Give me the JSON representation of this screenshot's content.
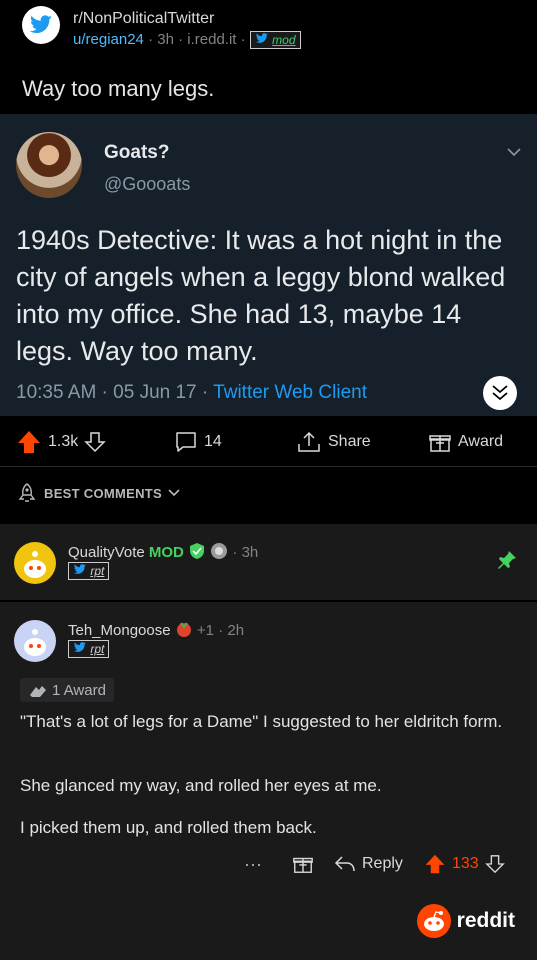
{
  "header": {
    "subreddit": "r/NonPoliticalTwitter",
    "user": "u/regian24",
    "age": "3h",
    "domain": "i.redd.it",
    "flair": "mod"
  },
  "post": {
    "title": "Way too many legs."
  },
  "tweet": {
    "name": "Goats?",
    "handle": "@Goooats",
    "text": "1940s Detective: It was a hot night in the city of angels when a leggy blond walked into my office. She had 13, maybe 14 legs. Way too many.",
    "time": "10:35 AM · 05 Jun 17 · ",
    "client": "Twitter Web Client"
  },
  "actions": {
    "votes": "1.3k",
    "comments": "14",
    "share": "Share",
    "award": "Award"
  },
  "sort": {
    "label": "BEST COMMENTS"
  },
  "comments": [
    {
      "user": "QualityVote",
      "mod_label": "MOD",
      "age": "· 3h",
      "flair": "rpt"
    },
    {
      "user": "Teh_Mongoose",
      "plus": "+1 · 2h",
      "flair": "rpt",
      "award": "1 Award",
      "paragraphs": [
        "\"That's a lot of legs for a Dame\" I suggested to her eldritch form.",
        "She glanced my way, and rolled her eyes at me.",
        "I picked them up, and rolled them back."
      ],
      "more": "···",
      "reply": "Reply",
      "score": "133"
    }
  ],
  "brand": {
    "name": "reddit"
  },
  "colors": {
    "upvote": "#ff4500",
    "twitter_bg": "#15202b",
    "twitter_blue": "#1d9bf0",
    "mod_green": "#46d160"
  }
}
